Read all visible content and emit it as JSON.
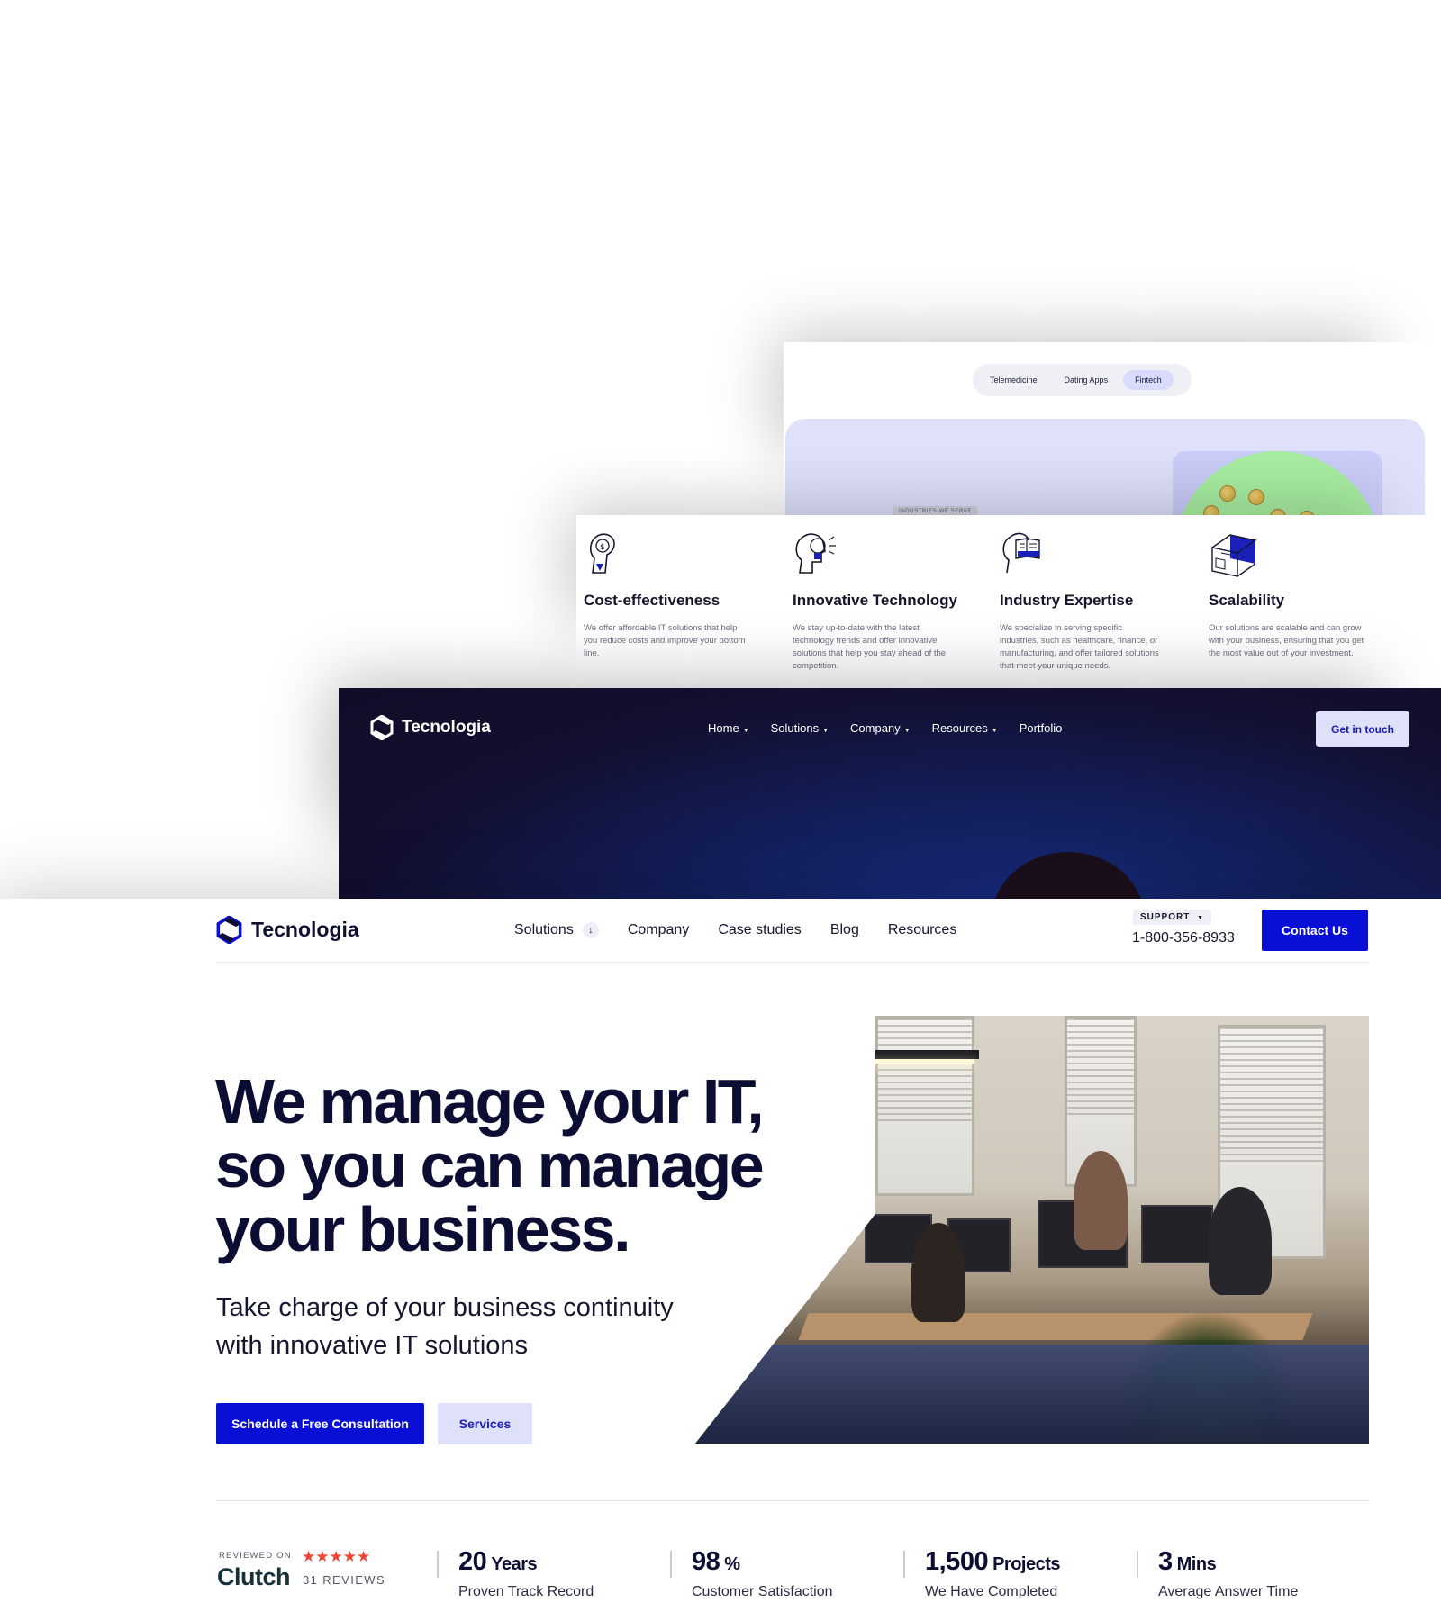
{
  "layer_industries": {
    "tabs": [
      "Telemedicine",
      "Dating Apps",
      "Fintech"
    ],
    "active_tab": "Fintech",
    "section_tag": "INDUSTRIES WE SERVE"
  },
  "layer_features": {
    "items": [
      {
        "title": "Cost-effectiveness",
        "text": "We offer affordable IT solutions that help you reduce costs and improve your bottom line.",
        "icon": "dollar-head-icon"
      },
      {
        "title": "Innovative Technology",
        "text": "We stay up-to-date with the latest technology trends and offer innovative solutions that help you stay ahead of the competition.",
        "icon": "lightbulb-head-icon"
      },
      {
        "title": "Industry Expertise",
        "text": "We specialize in serving specific industries, such as healthcare, finance, or manufacturing, and offer tailored solutions that meet your unique needs.",
        "icon": "book-head-icon"
      },
      {
        "title": "Scalability",
        "text": "Our solutions are scalable and can grow with your business, ensuring that you get the most value out of your investment.",
        "icon": "cube-scale-icon"
      }
    ]
  },
  "layer_dark": {
    "logo_text": "Tecnologia",
    "nav": [
      "Home",
      "Solutions",
      "Company",
      "Resources",
      "Portfolio"
    ],
    "nav_has_caret": [
      true,
      true,
      true,
      true,
      false
    ],
    "cta": "Get in touch"
  },
  "main": {
    "logo_text": "Tecnologia",
    "nav": [
      "Solutions",
      "Company",
      "Case studies",
      "Blog",
      "Resources"
    ],
    "support_label": "SUPPORT",
    "phone": "1-800-356-8933",
    "contact_button": "Contact Us",
    "hero_title_lines": [
      "We manage your IT,",
      "so you can manage",
      "your business."
    ],
    "hero_sub_lines": [
      "Take charge of your business continuity",
      "with innovative IT solutions"
    ],
    "primary_button": "Schedule a Free Consultation",
    "secondary_button": "Services",
    "clutch": {
      "reviewed_on": "REVIEWED ON",
      "brand": "Clutch",
      "stars": "★★★★★",
      "reviews": "31 REVIEWS"
    },
    "stats": [
      {
        "number": "20",
        "unit": "Years",
        "label": "Proven Track Record"
      },
      {
        "number": "98",
        "unit": "%",
        "label": "Customer Satisfaction"
      },
      {
        "number": "1,500",
        "unit": "Projects",
        "label": "We Have Completed"
      },
      {
        "number": "3",
        "unit": "Mins",
        "label": "Average Answer Time"
      }
    ]
  },
  "colors": {
    "brand_blue": "#0a0fd6",
    "light_lavender": "#dfe1fb",
    "navy_text": "#0c0d33",
    "dark_hero": "#110d28",
    "clutch_red": "#ef4335"
  }
}
